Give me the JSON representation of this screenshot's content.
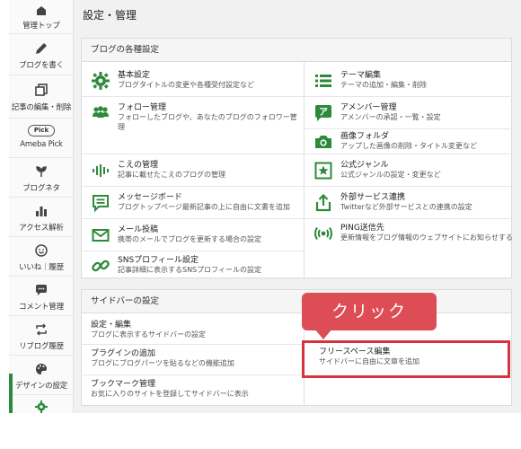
{
  "sidebar": {
    "items": [
      {
        "label": "管理トップ",
        "icon": "home-icon"
      },
      {
        "label": "ブログを書く",
        "icon": "pencil-icon"
      },
      {
        "label": "記事の編集・削除",
        "icon": "copy-icon"
      },
      {
        "label": "Ameba Pick",
        "badge": "Pick"
      },
      {
        "label": "ブログネタ",
        "icon": "sprout-icon"
      },
      {
        "label": "アクセス解析",
        "icon": "bar-chart-icon"
      },
      {
        "label": "いいね｜履歴",
        "icon": "smile-icon"
      },
      {
        "label": "コメント管理",
        "icon": "chat-icon"
      },
      {
        "label": "リブログ履歴",
        "icon": "reblog-icon"
      },
      {
        "label": "デザインの設定",
        "icon": "palette-icon"
      },
      {
        "label": "",
        "icon": "gear-icon"
      }
    ]
  },
  "page": {
    "title": "設定・管理"
  },
  "blog_settings": {
    "heading": "ブログの各種設定",
    "left": [
      {
        "title": "基本設定",
        "desc": "ブログタイトルの変更や各種受付設定など",
        "icon": "gear-icon"
      },
      {
        "title": "フォロー管理",
        "desc": "フォローしたブログや、あなたのブログのフォロワー管理",
        "icon": "users-icon"
      },
      {
        "title": "こえの管理",
        "desc": "記事に載せたこえのブログの管理",
        "icon": "voice-icon"
      },
      {
        "title": "メッセージボード",
        "desc": "ブログトップページ最新記事の上に自由に文書を追加",
        "icon": "message-board-icon"
      },
      {
        "title": "メール投稿",
        "desc": "携帯のメールでブログを更新する場合の設定",
        "icon": "mail-icon"
      },
      {
        "title": "SNSプロフィール設定",
        "desc": "記事詳細に表示するSNSプロフィールの設定",
        "icon": "link-icon"
      }
    ],
    "right": [
      {
        "title": "テーマ編集",
        "desc": "テーマの追加・編集・削除",
        "icon": "list-icon"
      },
      {
        "title": "アメンバー管理",
        "desc": "アメンバーの承認・一覧・設定",
        "icon": "amember-icon"
      },
      {
        "title": "画像フォルダ",
        "desc": "アップした画像の削除・タイトル変更など",
        "icon": "camera-icon"
      },
      {
        "title": "公式ジャンル",
        "desc": "公式ジャンルの設定・変更など",
        "icon": "star-icon"
      },
      {
        "title": "外部サービス連携",
        "desc": "Twitterなど外部サービスとの連携の設定",
        "icon": "share-icon"
      },
      {
        "title": "PING送信先",
        "desc": "更新情報をブログ情報のウェブサイトにお知らせする",
        "icon": "broadcast-icon"
      }
    ]
  },
  "sidebar_settings": {
    "heading": "サイドバーの設定",
    "left": [
      {
        "title": "設定・編集",
        "desc": "ブログに表示するサイドバーの設定"
      },
      {
        "title": "プラグインの追加",
        "desc": "ブログにブログパーツを貼るなどの機能追加"
      },
      {
        "title": "ブックマーク管理",
        "desc": "お気に入りのサイトを登録してサイドバーに表示"
      }
    ],
    "right": [
      {
        "title": "フリースペース編集",
        "desc": "サイドバーに自由に文章を追加"
      }
    ]
  },
  "callout": {
    "label": "クリック"
  },
  "colors": {
    "accent_green": "#2d8a3b",
    "highlight_red": "#d6343c",
    "callout_red": "#dd4d56"
  }
}
